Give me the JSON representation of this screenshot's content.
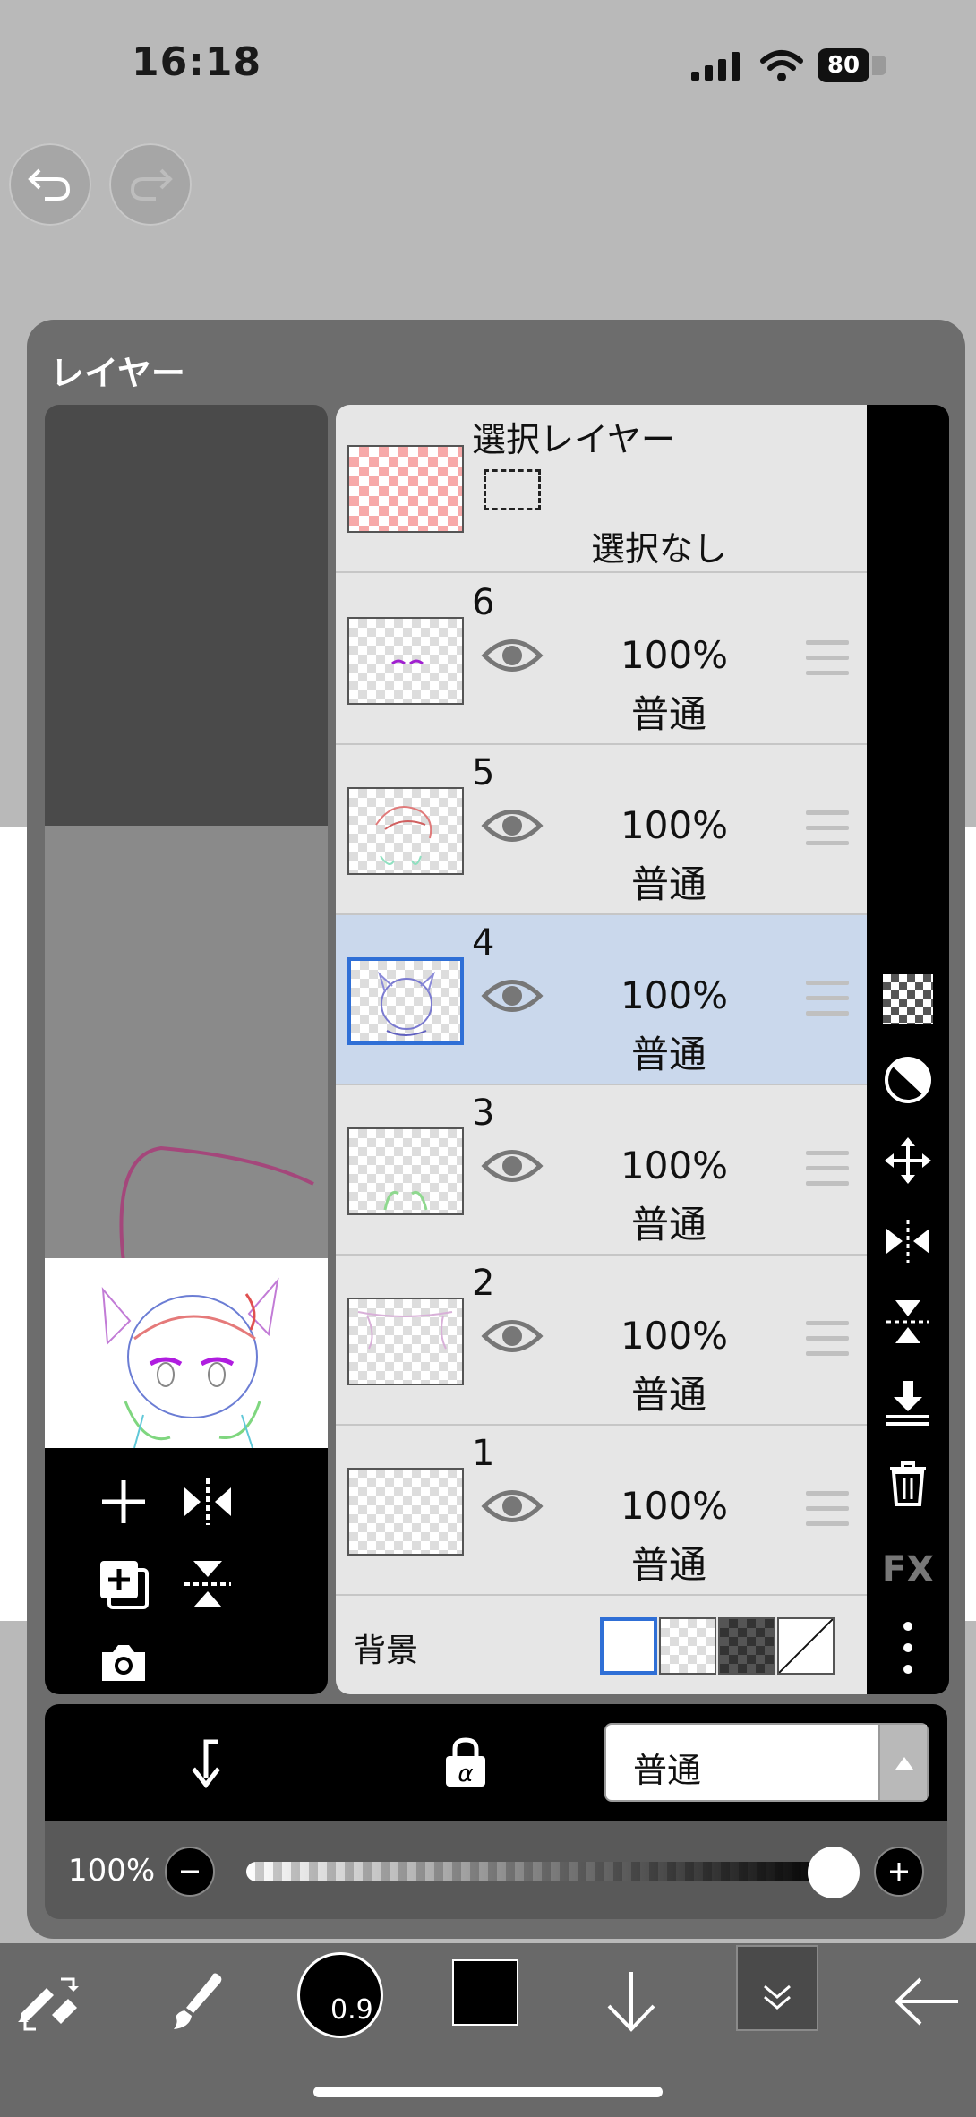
{
  "status_bar": {
    "time": "16:18",
    "battery": "80"
  },
  "panel": {
    "title": "レイヤー"
  },
  "selection_layer": {
    "label": "選択レイヤー",
    "status": "選択なし"
  },
  "layers": [
    {
      "number": "6",
      "opacity": "100%",
      "blend": "普通",
      "selected": false
    },
    {
      "number": "5",
      "opacity": "100%",
      "blend": "普通",
      "selected": false
    },
    {
      "number": "4",
      "opacity": "100%",
      "blend": "普通",
      "selected": true
    },
    {
      "number": "3",
      "opacity": "100%",
      "blend": "普通",
      "selected": false
    },
    {
      "number": "2",
      "opacity": "100%",
      "blend": "普通",
      "selected": false
    },
    {
      "number": "1",
      "opacity": "100%",
      "blend": "普通",
      "selected": false
    }
  ],
  "background": {
    "label": "背景",
    "options": [
      "white",
      "checker-light",
      "checker-dark",
      "none"
    ],
    "selected": "white"
  },
  "right_toolbar": {
    "fx_label": "FX",
    "icons": [
      "transparency-checker-icon",
      "invert-icon",
      "move-icon",
      "flip-horizontal-icon",
      "flip-vertical-icon",
      "merge-down-icon",
      "trash-icon",
      "fx-icon",
      "more-icon"
    ]
  },
  "controls": {
    "blend_mode": "普通",
    "opacity_label": "100%",
    "opacity_value": 1.0
  },
  "bottom_bar": {
    "brush_size": "0.9",
    "color": "#000000"
  },
  "colors": {
    "accent": "#2f6fd6",
    "selected_row": "#cad8ec"
  }
}
